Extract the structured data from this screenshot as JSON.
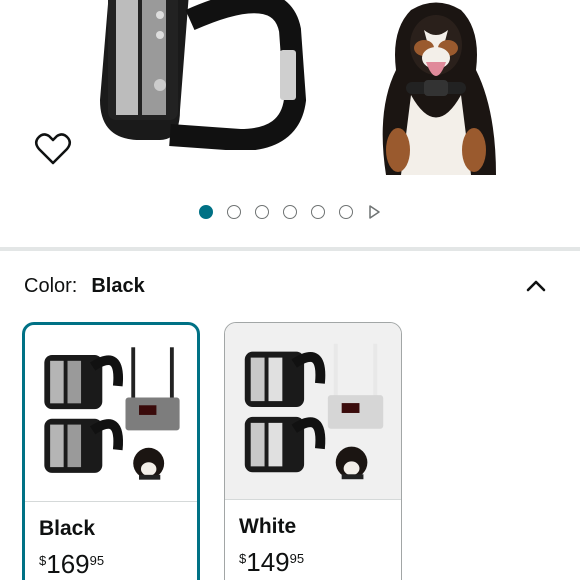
{
  "gallery": {
    "total_dots": 6,
    "active_index": 0
  },
  "variation": {
    "label": "Color:",
    "selected": "Black"
  },
  "swatches": [
    {
      "name": "Black",
      "currency": "$",
      "whole": "169",
      "fraction": "95",
      "selected": true
    },
    {
      "name": "White",
      "currency": "$",
      "whole": "149",
      "fraction": "95",
      "selected": false
    }
  ],
  "colors": {
    "accent": "#007185",
    "divider": "#e3e6e6",
    "text": "#0f1111"
  },
  "icons": [
    "heart-icon",
    "play-icon",
    "chevron-up-icon"
  ]
}
